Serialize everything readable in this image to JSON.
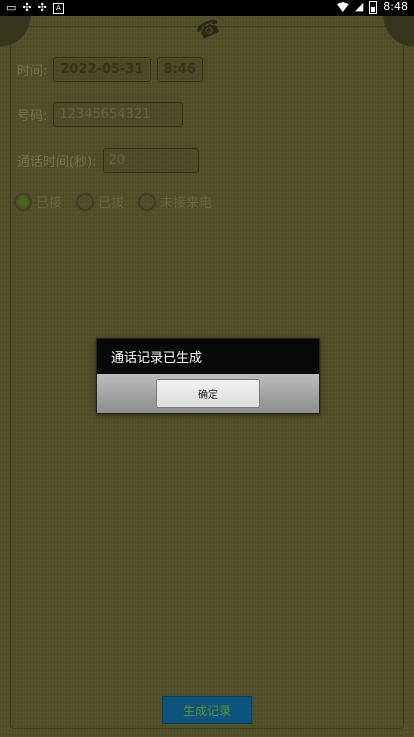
{
  "status_bar": {
    "left_icons": [
      "notification-icon",
      "bug-icon",
      "bug-icon",
      "a-icon"
    ],
    "time": "8:48"
  },
  "form": {
    "time_label": "时间:",
    "date_value": "2022-05-31",
    "time_value": "8:46",
    "number_label": "号码:",
    "number_value": "12345654321",
    "duration_label": "通话时间(秒):",
    "duration_value": "20",
    "radios": [
      {
        "label": "已接",
        "checked": true
      },
      {
        "label": "已拔",
        "checked": false
      },
      {
        "label": "未接来电",
        "checked": false
      }
    ]
  },
  "dialog": {
    "message": "通话记录已生成",
    "ok_label": "确定"
  },
  "actions": {
    "generate_label": "生成记录"
  },
  "colors": {
    "background": "#5d5a2e",
    "dialog_header": "#080808",
    "button_primary": "#0e5f8f"
  }
}
